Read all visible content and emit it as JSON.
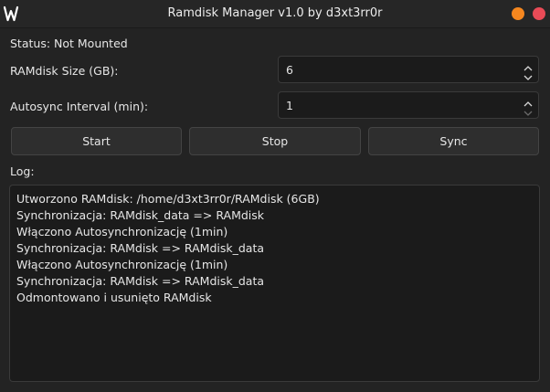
{
  "window": {
    "title": "Ramdisk Manager v1.0 by d3xt3rr0r",
    "icon": "w-logo-icon",
    "controls": {
      "minimize_color": "#f5871f",
      "close_color": "#e94b57"
    }
  },
  "status": {
    "text": "Status: Not Mounted"
  },
  "ramdisk_size": {
    "label": "RAMdisk Size (GB):",
    "value": "6"
  },
  "autosync_interval": {
    "label": "Autosync Interval (min):",
    "value": "1"
  },
  "buttons": {
    "start": "Start",
    "stop": "Stop",
    "sync": "Sync"
  },
  "log": {
    "label": "Log:",
    "lines": [
      "Utworzono RAMdisk: /home/d3xt3rr0r/RAMdisk (6GB)",
      "Synchronizacja: RAMdisk_data => RAMdisk",
      "Włączono Autosynchronizację (1min)",
      "Synchronizacja: RAMdisk => RAMdisk_data",
      "Włączono Autosynchronizację (1min)",
      "Synchronizacja: RAMdisk => RAMdisk_data",
      "Odmontowano i usunięto RAMdisk"
    ]
  }
}
